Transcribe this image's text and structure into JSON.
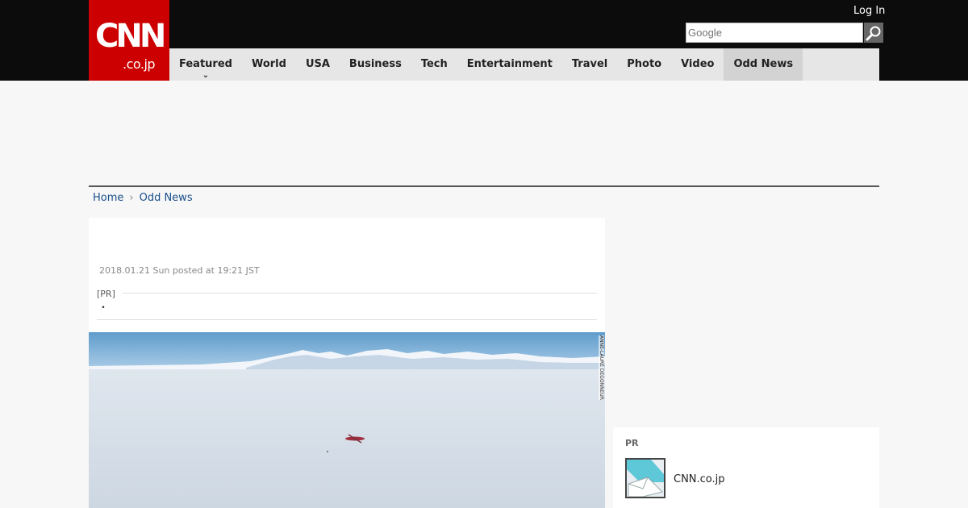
{
  "header": {
    "logo": {
      "main": "CNN",
      "sub": ".co.jp"
    },
    "login_label": "Log In",
    "search_placeholder": "Google"
  },
  "nav": {
    "items": [
      {
        "label": "Featured"
      },
      {
        "label": "World"
      },
      {
        "label": "USA"
      },
      {
        "label": "Business"
      },
      {
        "label": "Tech"
      },
      {
        "label": "Entertainment"
      },
      {
        "label": "Travel"
      },
      {
        "label": "Photo"
      },
      {
        "label": "Video"
      },
      {
        "label": "Odd News"
      }
    ],
    "active_item": "Odd News"
  },
  "breadcrumb": {
    "home": "Home",
    "current": "Odd News"
  },
  "article": {
    "date": "2018.01.21 Sun posted at 19:21 JST",
    "pr_label": "[PR]",
    "pr_text": "・",
    "photo_credit": "ANNE-LAURE DEGONNEUR"
  },
  "sidebar": {
    "pr_title": "PR",
    "pr_item_text": "CNN.co.jp"
  },
  "colors": {
    "brand_red": "#cc0000",
    "topbar": "#0c0c0c",
    "nav_bg": "#e6e6e6",
    "link": "#1a4f8a"
  }
}
